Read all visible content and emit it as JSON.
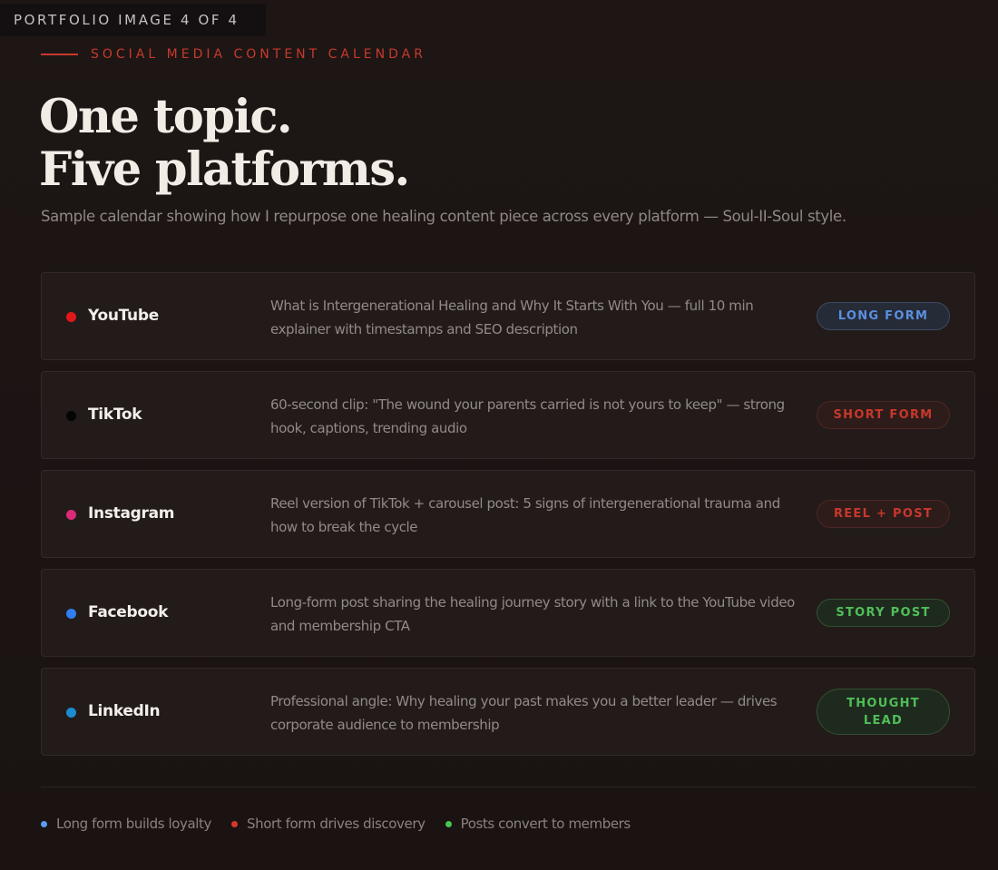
{
  "portfolio_tag": "PORTFOLIO IMAGE 4 OF 4",
  "eyebrow": "SOCIAL MEDIA CONTENT CALENDAR",
  "headline": {
    "line1": "One topic.",
    "line2": "Five platforms."
  },
  "subtitle": "Sample calendar showing how I repurpose one healing content piece across every platform — Soul-II-Soul style.",
  "platforms": [
    {
      "name": "YouTube",
      "dot_color": "#e01818",
      "description": "What is Intergenerational Healing and Why It Starts With You — full 10 min explainer with timestamps and SEO description",
      "badge": "LONG FORM",
      "badge_color": "#5b8fe0",
      "badge_bg": "#262b38",
      "badge_border": "#3d4a63"
    },
    {
      "name": "TikTok",
      "dot_color": "#050505",
      "description": "60-second clip: \"The wound your parents carried is not yours to keep\" — strong hook, captions, trending audio",
      "badge": "SHORT FORM",
      "badge_color": "#c7382c",
      "badge_bg": "#2e1c1a",
      "badge_border": "#4d2723"
    },
    {
      "name": "Instagram",
      "dot_color": "#d92b78",
      "description": "Reel version of TikTok + carousel post: 5 signs of intergenerational trauma and how to break the cycle",
      "badge": "REEL + POST",
      "badge_color": "#c7382c",
      "badge_bg": "#2e1c1a",
      "badge_border": "#4d2723"
    },
    {
      "name": "Facebook",
      "dot_color": "#2f7ff0",
      "description": "Long-form post sharing the healing journey story with a link to the YouTube video and membership CTA",
      "badge": "STORY POST",
      "badge_color": "#4fbf58",
      "badge_bg": "#1f2a1e",
      "badge_border": "#33502f"
    },
    {
      "name": "LinkedIn",
      "dot_color": "#1c8bd0",
      "description": "Professional angle: Why healing your past makes you a better leader — drives corporate audience to membership",
      "badge": "THOUGHT LEAD",
      "badge_color": "#4fbf58",
      "badge_bg": "#1f2a1e",
      "badge_border": "#33502f"
    }
  ],
  "legend": [
    {
      "color": "#5b9cf0",
      "text": "Long form builds loyalty"
    },
    {
      "color": "#d8382b",
      "text": "Short form drives discovery"
    },
    {
      "color": "#46c651",
      "text": "Posts convert to members"
    }
  ]
}
